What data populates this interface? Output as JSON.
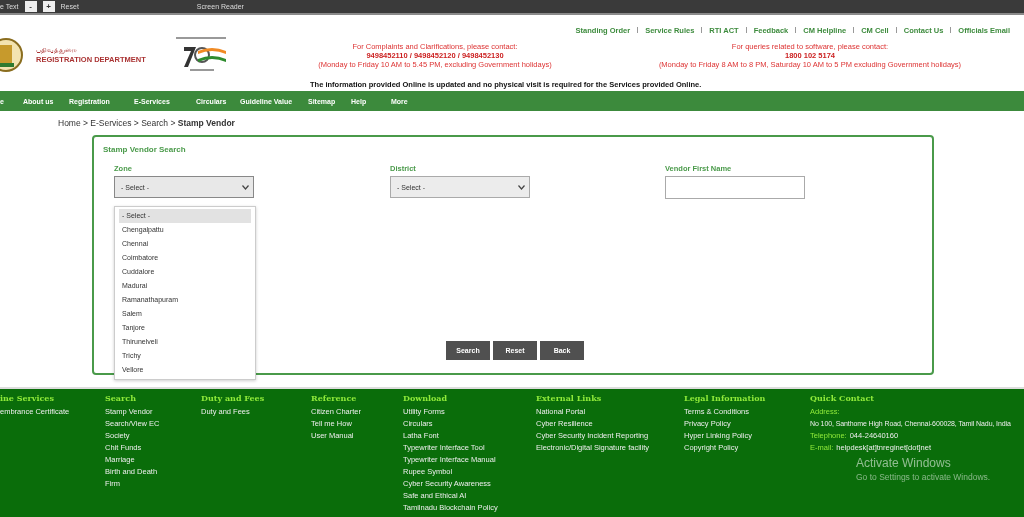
{
  "top_bar": {
    "items": [
      {
        "kind": "text",
        "label": "e Text"
      },
      {
        "kind": "button",
        "label": "-"
      },
      {
        "kind": "button",
        "label": "+"
      },
      {
        "kind": "text",
        "label": "Reset"
      },
      {
        "kind": "spacer-text",
        "label": "Screen Reader"
      }
    ]
  },
  "header": {
    "tamil_title": "பதிவுத்துறை",
    "department": "REGISTRATION DEPARTMENT",
    "top_links": [
      "Standing Order",
      "Service Rules",
      "RTI ACT",
      "Feedback",
      "CM Helpline",
      "CM Cell",
      "Contact Us",
      "Officials Email"
    ],
    "complaints": {
      "heading": "For Complaints and Clarifications, please contact:",
      "phones": "9498452110 / 9498452120 / 9498452130",
      "hours": "(Monday to Friday 10 AM to 5.45 PM, excluding Government holidays)"
    },
    "software": {
      "heading": "For queries related to software, please contact:",
      "phone": "1800 102 5174",
      "hours": "(Monday to Friday 8 AM to 8 PM, Saturday 10 AM to 5 PM excluding Government holidays)"
    },
    "notice": "The information provided Online is updated and no physical visit is required for the Services provided Online."
  },
  "nav": {
    "items": [
      "e",
      "About us",
      "Registration",
      "E-Services",
      "Circulars",
      "Guideline Value",
      "Sitemap",
      "Help",
      "More"
    ]
  },
  "breadcrumb": "Home > E-Services > Search > **Stamp Vendor**",
  "form": {
    "title": "Stamp Vendor Search",
    "fields": [
      {
        "kind": "select",
        "label": "Zone",
        "value": "- Select -",
        "expanded": true,
        "options": [
          {
            "label": "- Select -",
            "selected": true
          },
          {
            "label": "Chengalpattu",
            "selected": false
          },
          {
            "label": "Chennai",
            "selected": false
          },
          {
            "label": "Coimbatore",
            "selected": false
          },
          {
            "label": "Cuddalore",
            "selected": false
          },
          {
            "label": "Madurai",
            "selected": false
          },
          {
            "label": "Ramanathapuram",
            "selected": false
          },
          {
            "label": "Salem",
            "selected": false
          },
          {
            "label": "Tanjore",
            "selected": false
          },
          {
            "label": "Thirunelveli",
            "selected": false
          },
          {
            "label": "Trichy",
            "selected": false
          },
          {
            "label": "Vellore",
            "selected": false
          }
        ]
      },
      {
        "kind": "select",
        "label": "District",
        "value": "- Select -",
        "expanded": false
      },
      {
        "kind": "text",
        "label": "Vendor First Name"
      }
    ],
    "buttons": [
      "Search",
      "Reset",
      "Back"
    ]
  },
  "footer": {
    "columns": [
      {
        "heading": "ine Services",
        "items": [
          "embrance Certificate"
        ]
      },
      {
        "heading": "Search",
        "items": [
          "Stamp Vendor",
          "Search/View EC",
          "Society",
          "Chit Funds",
          "Marriage",
          "Birth and Death",
          "Firm"
        ]
      },
      {
        "heading": "Duty and Fees",
        "items": [
          "Duty and Fees"
        ]
      },
      {
        "heading": "Reference",
        "items": [
          "Citizen Charter",
          "Tell me How",
          "User Manual"
        ]
      },
      {
        "heading": "Download",
        "items": [
          "Utility Forms",
          "Circulars",
          "Latha Font",
          "Typewriter Interface Tool",
          "Typewriter Interface Manual",
          "Rupee Symbol",
          "Cyber Security Awareness",
          "Safe and Ethical AI",
          "Tamilnadu Blockchain Policy"
        ]
      },
      {
        "heading": "External Links",
        "items": [
          "National Portal",
          "Cyber Resilience",
          "Cyber Security Incident Reporting",
          "Electronic/Digital Signature facility"
        ]
      },
      {
        "heading": "Legal Information",
        "items": [
          "Terms & Conditions",
          "Privacy Policy",
          "Hyper Linking Policy",
          "Copyright Policy"
        ]
      }
    ],
    "quick_contact": {
      "heading": "Quick Contact",
      "address_label": "Address:",
      "address": "No 100, Santhome High Road, Chennai-600028, Tamil Nadu, India",
      "telephone_label": "Telephone:",
      "telephone": "044-24640160",
      "email_label": "E-mail:",
      "email": "helpdesk[at]tnreginet[dot]net"
    }
  },
  "os_overlay": {
    "title": "Activate Windows",
    "subtitle": "Go to Settings to activate Windows."
  }
}
